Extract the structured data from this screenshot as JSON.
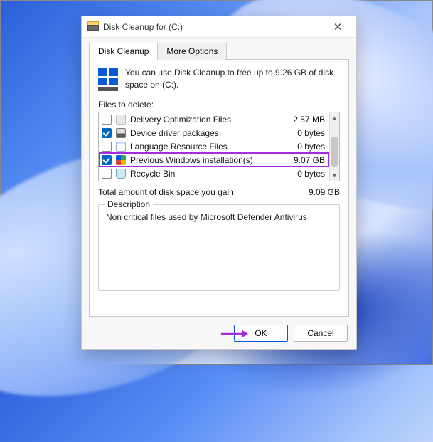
{
  "window": {
    "title": "Disk Cleanup for  (C:)"
  },
  "tabs": {
    "cleanup": "Disk Cleanup",
    "more": "More Options"
  },
  "intro": "You can use Disk Cleanup to free up to 9.26 GB of disk space on  (C:).",
  "files_label": "Files to delete:",
  "rows": [
    {
      "name": "Delivery Optimization Files",
      "size": "2.57 MB",
      "checked": false,
      "icon": "box"
    },
    {
      "name": "Device driver packages",
      "size": "0 bytes",
      "checked": true,
      "icon": "disk"
    },
    {
      "name": "Language Resource Files",
      "size": "0 bytes",
      "checked": false,
      "icon": "page"
    },
    {
      "name": "Previous Windows installation(s)",
      "size": "9.07 GB",
      "checked": true,
      "icon": "win",
      "highlight": true
    },
    {
      "name": "Recycle Bin",
      "size": "0 bytes",
      "checked": false,
      "icon": "bin"
    }
  ],
  "total": {
    "label": "Total amount of disk space you gain:",
    "value": "9.09 GB"
  },
  "description": {
    "title": "Description",
    "text": "Non critical files used by Microsoft Defender Antivirus"
  },
  "buttons": {
    "ok": "OK",
    "cancel": "Cancel"
  },
  "colors": {
    "accent": "#0a5ad6",
    "annotation": "#a32be0"
  }
}
